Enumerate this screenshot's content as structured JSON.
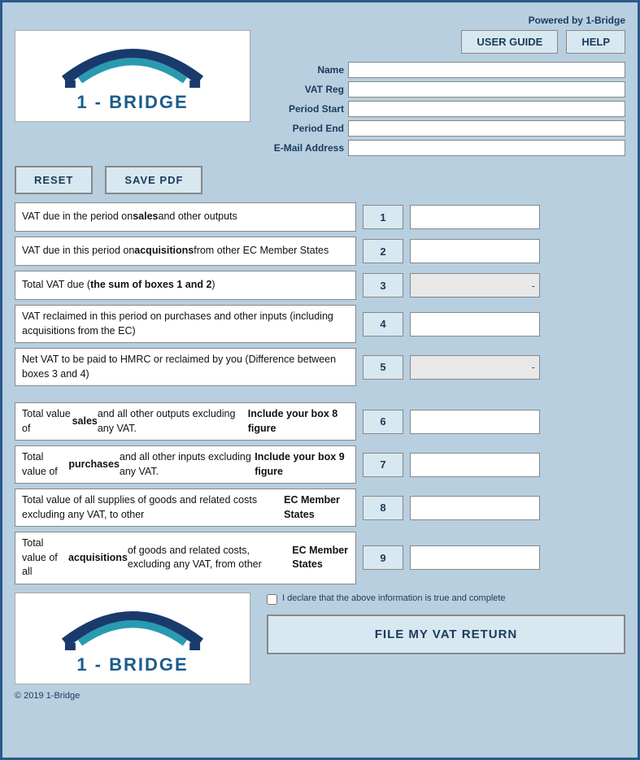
{
  "app": {
    "powered_by": "Powered by 1-Bridge",
    "copyright": "© 2019 1-Bridge"
  },
  "header": {
    "user_guide_label": "USER GUIDE",
    "help_label": "HELP"
  },
  "logo": {
    "text": "1 - BRIDGE"
  },
  "action_buttons": {
    "reset_label": "RESET",
    "save_pdf_label": "SAVE PDF"
  },
  "form": {
    "name_label": "Name",
    "vat_reg_label": "VAT Reg",
    "period_start_label": "Period Start",
    "period_end_label": "Period End",
    "email_label": "E-Mail Address",
    "name_value": "",
    "vat_reg_value": "",
    "period_start_value": "",
    "period_end_value": "",
    "email_value": ""
  },
  "vat_rows": [
    {
      "id": "box1",
      "description_html": "VAT due in the period on <b>sales</b> and other outputs",
      "box_number": "1",
      "value": ""
    },
    {
      "id": "box2",
      "description_html": "VAT due in this period on <b>acquisitions</b> from other EC Member States",
      "box_number": "2",
      "value": ""
    },
    {
      "id": "box3",
      "description_html": "Total VAT due (<b>the sum of boxes 1 and 2</b>)",
      "box_number": "3",
      "value": "-"
    },
    {
      "id": "box4",
      "description_html": "VAT reclaimed in this period on purchases and other inputs (including acquisitions from the EC)",
      "box_number": "4",
      "value": ""
    },
    {
      "id": "box5",
      "description_html": "Net VAT to be paid to HMRC or reclaimed by you (Difference between boxes 3 and 4)",
      "box_number": "5",
      "value": "-"
    },
    {
      "id": "box6",
      "description_html": "Total value of <b>sales</b> and all other outputs excluding any VAT. <b>Include your box 8 figure</b>",
      "box_number": "6",
      "value": ""
    },
    {
      "id": "box7",
      "description_html": "Total value of <b>purchases</b> and all other inputs excluding any VAT. <b>Include your box 9 figure</b>",
      "box_number": "7",
      "value": ""
    },
    {
      "id": "box8",
      "description_html": "Total value of all supplies of goods and related costs excluding any VAT, to other <b>EC Member States</b>",
      "box_number": "8",
      "value": ""
    },
    {
      "id": "box9",
      "description_html": "Total value of all <b>acquisitions</b> of goods and related costs, excluding any VAT, from other <b>EC Member States</b>",
      "box_number": "9",
      "value": ""
    }
  ],
  "declaration": {
    "text": "I declare that the above information is true and complete"
  },
  "file_btn": {
    "label": "FILE MY VAT RETURN"
  }
}
